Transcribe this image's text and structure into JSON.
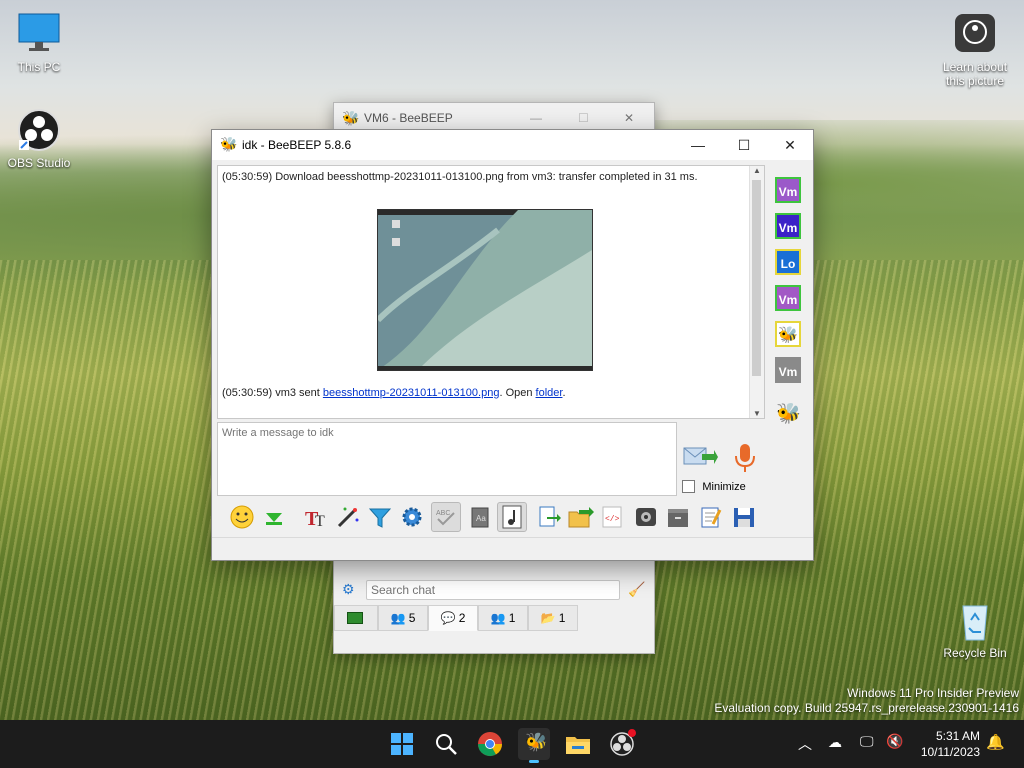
{
  "desktop": {
    "icons": [
      {
        "label": "This PC"
      },
      {
        "label": "OBS Studio"
      },
      {
        "label": "Learn about this picture"
      },
      {
        "label": "Recycle Bin"
      }
    ],
    "watermark_line1": "Windows 11 Pro Insider Preview",
    "watermark_line2": "Evaluation copy. Build 25947.rs_prerelease.230901-1416"
  },
  "back_window": {
    "title": "VM6 - BeeBEEP",
    "search_placeholder": "Search chat",
    "tabs": [
      {
        "label": ""
      },
      {
        "label": "5"
      },
      {
        "label": "2"
      },
      {
        "label": "1"
      },
      {
        "label": "1"
      }
    ]
  },
  "window": {
    "title": "idk - BeeBEEP 5.8.6",
    "controls": {
      "minimize": "—",
      "maximize": "☐",
      "close": "✕"
    },
    "chat": {
      "line1": "(05:30:59)  Download beesshottmp-20231011-013100.png from vm3: transfer completed in 31 ms.",
      "line2_prefix": "(05:30:59)  vm3 sent ",
      "line2_file": "beesshottmp-20231011-013100.png",
      "line2_mid": ". Open ",
      "line2_link": "folder",
      "line2_suffix": "."
    },
    "message_placeholder": "Write a message to idk",
    "minimize_label": "Minimize",
    "sidebar_avatars": [
      {
        "text": "Vm",
        "bg": "#9b59c9",
        "border": "#3ec43e"
      },
      {
        "text": "Vm",
        "bg": "#3b22c8",
        "border": "#3ec43e"
      },
      {
        "text": "Lo",
        "bg": "#1a6fd6",
        "border": "#e6d63a"
      },
      {
        "text": "Vm",
        "bg": "#a259c5",
        "border": "#3ec43e"
      },
      {
        "text": "",
        "bg": "#ffffff",
        "border": "#e6d63a"
      },
      {
        "text": "Vm",
        "bg": "#8a8a8a",
        "border": "#8a8a8a"
      }
    ]
  },
  "taskbar": {
    "time": "5:31 AM",
    "date": "10/11/2023"
  }
}
